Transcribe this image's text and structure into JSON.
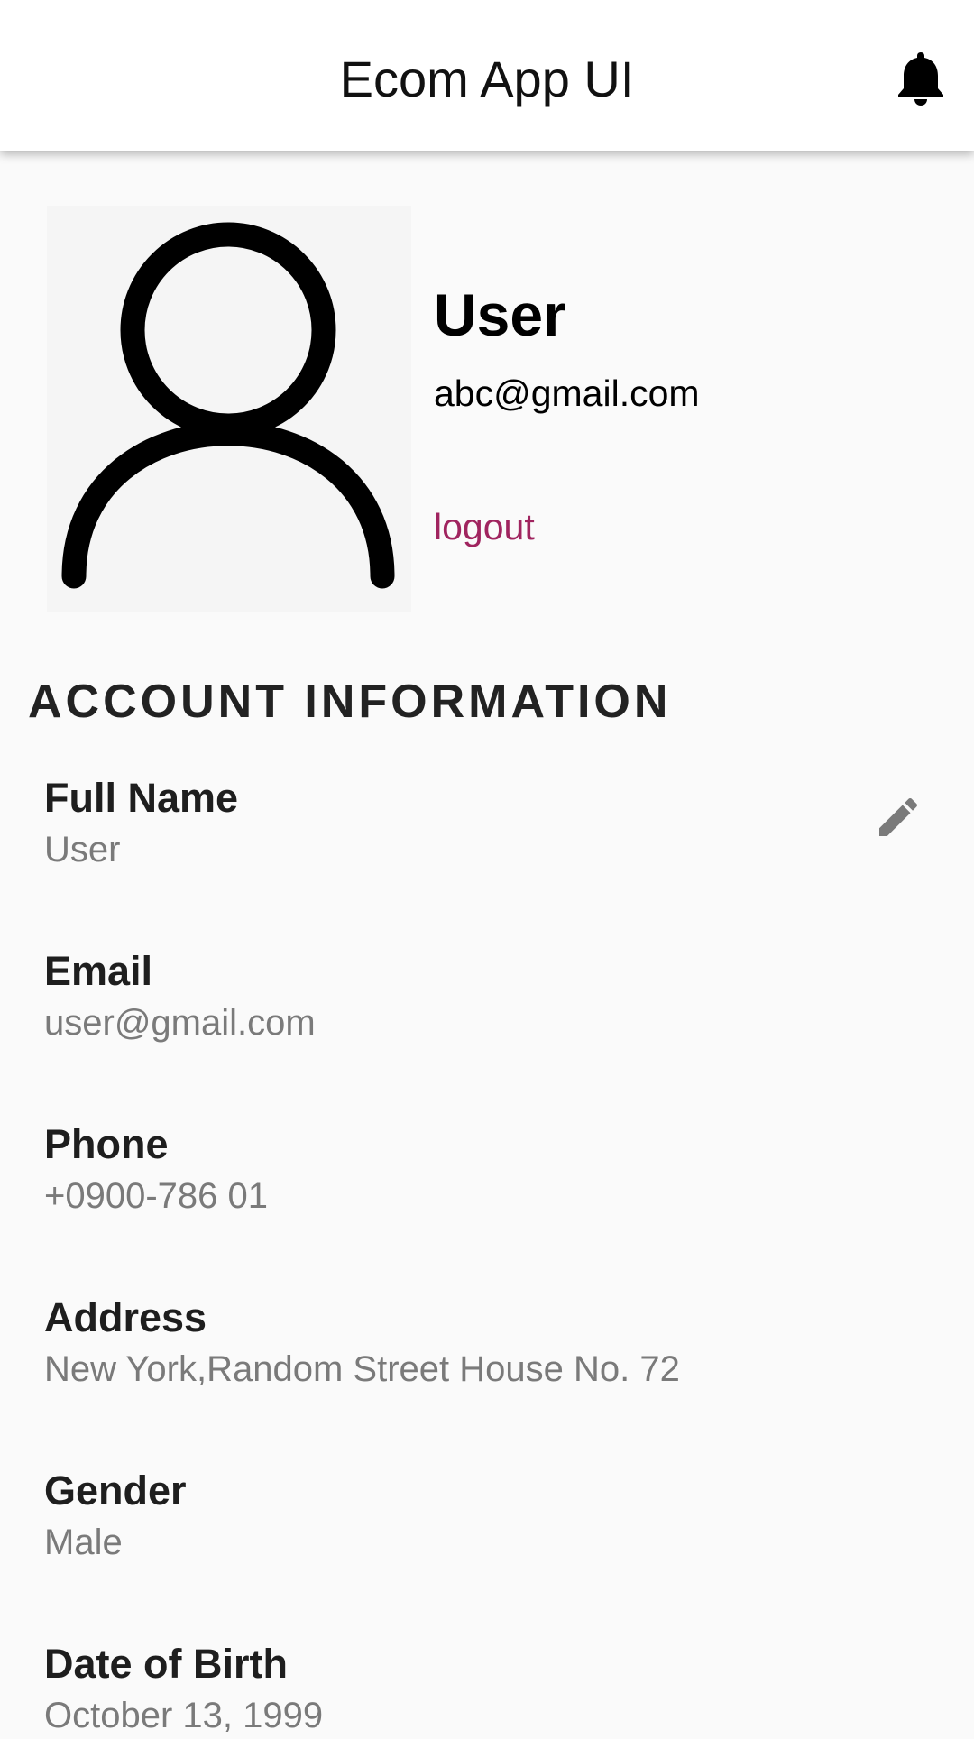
{
  "app_bar": {
    "title": "Ecom App UI",
    "notification_icon": "bell-icon"
  },
  "profile": {
    "avatar_icon": "user-outline-icon",
    "name": "User",
    "email": "abc@gmail.com",
    "logout_label": "logout"
  },
  "account": {
    "section_title": "ACCOUNT INFORMATION",
    "edit_icon": "pencil-icon",
    "fields": [
      {
        "label": "Full Name",
        "value": "User"
      },
      {
        "label": "Email",
        "value": "user@gmail.com"
      },
      {
        "label": "Phone",
        "value": "+0900-786 01"
      },
      {
        "label": "Address",
        "value": "New York,Random Street House No. 72"
      },
      {
        "label": "Gender",
        "value": "Male"
      },
      {
        "label": "Date of Birth",
        "value": "October 13, 1999"
      }
    ]
  },
  "colors": {
    "background": "#fafafa",
    "app_bar": "#ffffff",
    "logout": "#a0245f",
    "label": "#1e1e1e",
    "value": "#7a7a7a"
  }
}
